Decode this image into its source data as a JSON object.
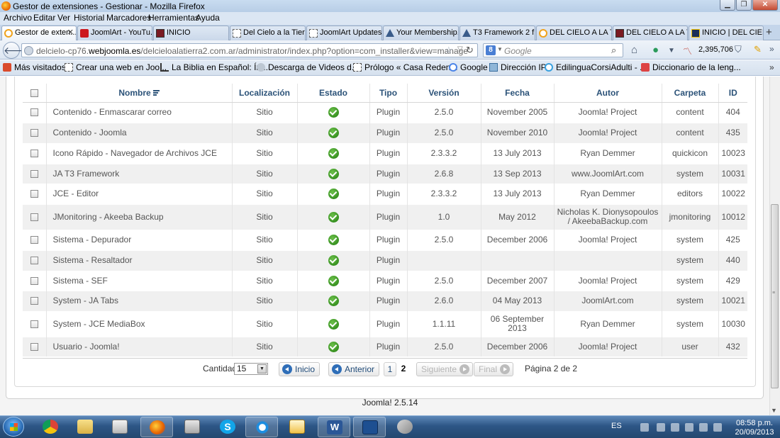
{
  "window": {
    "title": "Gestor de extensiones - Gestionar - Mozilla Firefox",
    "buttons": [
      "minimize",
      "maximize",
      "close"
    ]
  },
  "menu": [
    "Archivo",
    "Editar",
    "Ver",
    "Historial",
    "Marcadores",
    "Herramientas",
    "Ayuda"
  ],
  "tabs": [
    {
      "label": "Gestor de exten...",
      "icon": "joomla-icon",
      "active": true
    },
    {
      "label": "JoomlArt - YouTu...",
      "icon": "youtube-icon"
    },
    {
      "label": "INICIO",
      "icon": "cube-icon"
    },
    {
      "label": "Del Cielo a la Tierr...",
      "icon": "page-icon"
    },
    {
      "label": "JoomlArt Updates ...",
      "icon": "page-icon"
    },
    {
      "label": "Your Membership...",
      "icon": "triangle-icon"
    },
    {
      "label": "T3 Framework 2 f...",
      "icon": "triangle-icon"
    },
    {
      "label": "DEL CIELO A LA TI...",
      "icon": "joomla-icon"
    },
    {
      "label": "DEL CIELO A LA TI...",
      "icon": "cube-icon"
    },
    {
      "label": "INICIO | DEL CIEL...",
      "icon": "inicio-icon"
    }
  ],
  "nav": {
    "url_prefix": "delcielo-cp76.",
    "url_domain": "webjoomla.es",
    "url_path": "/delcieloalatierra2.com.ar/administrator/index.php?option=com_installer&view=manage",
    "search_placeholder": "Google",
    "counter": "2,395,706"
  },
  "bookmarks": [
    {
      "label": "Más visitados",
      "icon": "star"
    },
    {
      "label": "Crear una web en Joo...",
      "icon": "page"
    },
    {
      "label": "La Biblia en Español: Ín...",
      "icon": "bible"
    },
    {
      "label": "Descarga de Videos d...",
      "icon": "cloud"
    },
    {
      "label": "Prólogo « Casa Reden...",
      "icon": "page"
    },
    {
      "label": "Google",
      "icon": "google"
    },
    {
      "label": "Dirección IP",
      "icon": "ip"
    },
    {
      "label": "EdilinguaCorsiAdulti - ...",
      "icon": "edil"
    },
    {
      "label": "Diccionario de la leng...",
      "icon": "dic"
    }
  ],
  "table": {
    "headers": {
      "name": "Nombre",
      "location": "Localización",
      "status": "Estado",
      "type": "Tipo",
      "version": "Versión",
      "date": "Fecha",
      "author": "Autor",
      "folder": "Carpeta",
      "id": "ID"
    },
    "rows": [
      {
        "name": "Contenido - Enmascarar correo",
        "location": "Sitio",
        "type": "Plugin",
        "version": "2.5.0",
        "date": "November 2005",
        "author": "Joomla! Project",
        "folder": "content",
        "id": "404"
      },
      {
        "name": "Contenido - Joomla",
        "location": "Sitio",
        "type": "Plugin",
        "version": "2.5.0",
        "date": "November 2010",
        "author": "Joomla! Project",
        "folder": "content",
        "id": "435"
      },
      {
        "name": "Icono Rápido - Navegador de Archivos JCE",
        "location": "Sitio",
        "type": "Plugin",
        "version": "2.3.3.2",
        "date": "13 July 2013",
        "author": "Ryan Demmer",
        "folder": "quickicon",
        "id": "10023"
      },
      {
        "name": "JA T3 Framework",
        "location": "Sitio",
        "type": "Plugin",
        "version": "2.6.8",
        "date": "13 Sep 2013",
        "author": "www.JoomlArt.com",
        "folder": "system",
        "id": "10031"
      },
      {
        "name": "JCE - Editor",
        "location": "Sitio",
        "type": "Plugin",
        "version": "2.3.3.2",
        "date": "13 July 2013",
        "author": "Ryan Demmer",
        "folder": "editors",
        "id": "10022"
      },
      {
        "name": "JMonitoring - Akeeba Backup",
        "location": "Sitio",
        "type": "Plugin",
        "version": "1.0",
        "date": "May 2012",
        "author": "Nicholas K. Dionysopoulos / AkeebaBackup.com",
        "folder": "jmonitoring",
        "id": "10012"
      },
      {
        "name": "Sistema - Depurador",
        "location": "Sitio",
        "type": "Plugin",
        "version": "2.5.0",
        "date": "December 2006",
        "author": "Joomla! Project",
        "folder": "system",
        "id": "425"
      },
      {
        "name": "Sistema - Resaltador",
        "location": "Sitio",
        "type": "Plugin",
        "version": "",
        "date": "",
        "author": "",
        "folder": "system",
        "id": "440"
      },
      {
        "name": "Sistema - SEF",
        "location": "Sitio",
        "type": "Plugin",
        "version": "2.5.0",
        "date": "December 2007",
        "author": "Joomla! Project",
        "folder": "system",
        "id": "429"
      },
      {
        "name": "System - JA Tabs",
        "location": "Sitio",
        "type": "Plugin",
        "version": "2.6.0",
        "date": "04 May 2013",
        "author": "JoomlArt.com",
        "folder": "system",
        "id": "10021"
      },
      {
        "name": "System - JCE MediaBox",
        "location": "Sitio",
        "type": "Plugin",
        "version": "1.1.11",
        "date": "06 September 2013",
        "author": "Ryan Demmer",
        "folder": "system",
        "id": "10030"
      },
      {
        "name": "Usuario - Joomla!",
        "location": "Sitio",
        "type": "Plugin",
        "version": "2.5.0",
        "date": "December 2006",
        "author": "Joomla! Project",
        "folder": "user",
        "id": "432"
      }
    ]
  },
  "pagination": {
    "limit_label": "Cantidad",
    "limit_value": "15",
    "start": "Inicio",
    "prev": "Anterior",
    "pages": [
      "1",
      "2"
    ],
    "current_page": "2",
    "next": "Siguiente",
    "end": "Final",
    "info": "Página 2 de 2"
  },
  "footer": "Joomla! 2.5.14",
  "taskbar": {
    "lang": "ES",
    "time": "08:58 p.m.",
    "date": "20/09/2013"
  }
}
